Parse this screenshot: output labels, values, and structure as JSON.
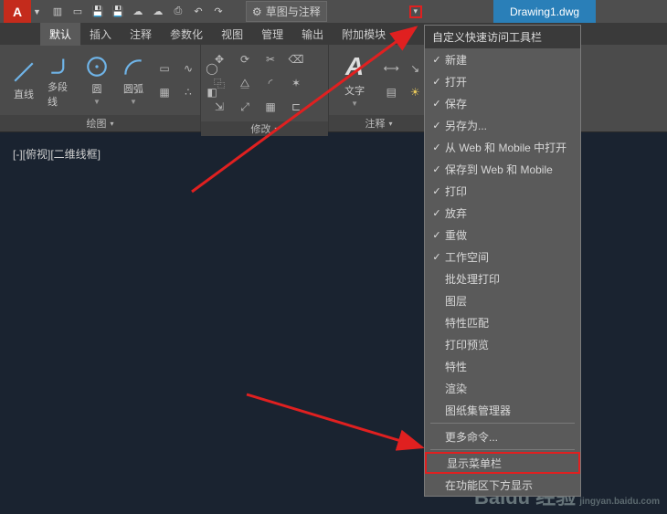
{
  "app": {
    "logo_text": "A",
    "workspace_label": "草图与注释"
  },
  "doc_tab": "Drawing1.dwg",
  "menus": [
    "默认",
    "插入",
    "注释",
    "参数化",
    "视图",
    "管理",
    "输出",
    "附加模块"
  ],
  "panels": {
    "draw": {
      "title": "绘图",
      "line": "直线",
      "polyline": "多段线",
      "circle": "圆",
      "arc": "圆弧"
    },
    "modify": {
      "title": "修改"
    },
    "annotate": {
      "title": "注释",
      "text": "文字",
      "A": "A"
    }
  },
  "view_label": "[-][俯视][二维线框]",
  "customize": {
    "title": "自定义快速访问工具栏",
    "items": [
      {
        "label": "新建",
        "checked": true
      },
      {
        "label": "打开",
        "checked": true
      },
      {
        "label": "保存",
        "checked": true
      },
      {
        "label": "另存为...",
        "checked": true
      },
      {
        "label": "从 Web 和 Mobile 中打开",
        "checked": true
      },
      {
        "label": "保存到 Web 和 Mobile",
        "checked": true
      },
      {
        "label": "打印",
        "checked": true
      },
      {
        "label": "放弃",
        "checked": true
      },
      {
        "label": "重做",
        "checked": true
      },
      {
        "label": "工作空间",
        "checked": true
      },
      {
        "label": "批处理打印",
        "checked": false
      },
      {
        "label": "图层",
        "checked": false
      },
      {
        "label": "特性匹配",
        "checked": false
      },
      {
        "label": "打印预览",
        "checked": false
      },
      {
        "label": "特性",
        "checked": false
      },
      {
        "label": "渲染",
        "checked": false
      },
      {
        "label": "图纸集管理器",
        "checked": false
      },
      {
        "label": "更多命令...",
        "checked": false,
        "sep_before": true
      },
      {
        "label": "显示菜单栏",
        "checked": false,
        "sep_before": true,
        "highlight": true
      },
      {
        "label": "在功能区下方显示",
        "checked": false
      }
    ]
  },
  "watermark": {
    "brand": "Baidu 经验",
    "sub": "jingyan.baidu.com"
  }
}
